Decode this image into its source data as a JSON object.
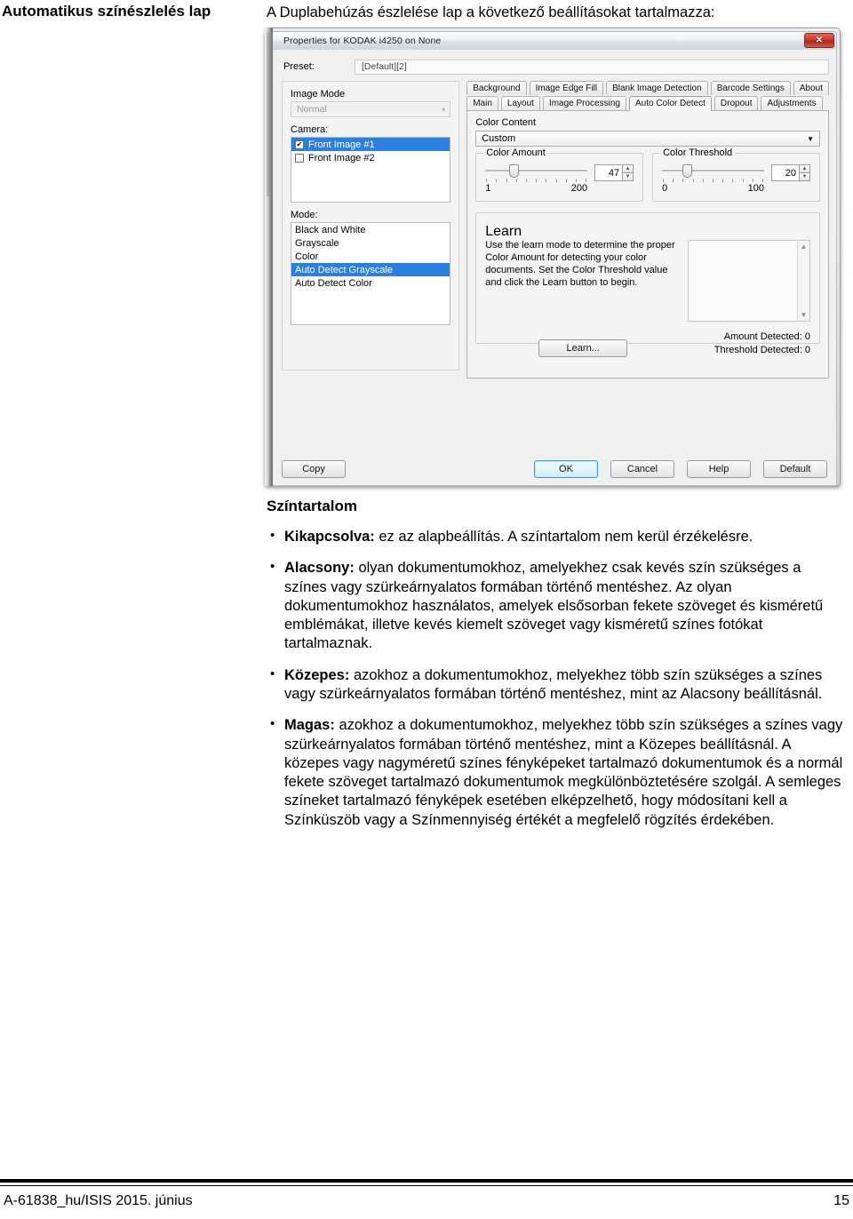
{
  "side_heading": "Automatikus színészlelés lap",
  "intro": "A Duplabehúzás észlelése lap a következő beállításokat tartalmazza:",
  "dialog": {
    "title": "Properties for KODAK i4250 on None",
    "close_icon": "close-icon",
    "preset": {
      "label": "Preset:",
      "value": "[Default][2]"
    },
    "image_mode": {
      "label": "Image Mode",
      "value": "Normal",
      "arrow": "▾"
    },
    "camera": {
      "label": "Camera:",
      "items": [
        {
          "label": "Front Image #1",
          "checked": true,
          "selected": true
        },
        {
          "label": "Front Image #2",
          "checked": false,
          "selected": false
        }
      ]
    },
    "mode": {
      "label": "Mode:",
      "items": [
        {
          "label": "Black and White",
          "selected": false
        },
        {
          "label": "Grayscale",
          "selected": false
        },
        {
          "label": "Color",
          "selected": false
        },
        {
          "label": "Auto Detect Grayscale",
          "selected": true
        },
        {
          "label": "Auto Detect Color",
          "selected": false
        }
      ]
    },
    "tabs_row1": [
      {
        "label": "Background",
        "active": false
      },
      {
        "label": "Image Edge Fill",
        "active": false
      },
      {
        "label": "Blank Image Detection",
        "active": false
      },
      {
        "label": "Barcode Settings",
        "active": false
      },
      {
        "label": "About",
        "active": false
      }
    ],
    "tabs_row2": [
      {
        "label": "Main",
        "active": false
      },
      {
        "label": "Layout",
        "active": false
      },
      {
        "label": "Image Processing",
        "active": false
      },
      {
        "label": "Auto Color Detect",
        "active": true
      },
      {
        "label": "Dropout",
        "active": false
      },
      {
        "label": "Adjustments",
        "active": false
      }
    ],
    "color_content": {
      "label": "Color Content",
      "value": "Custom",
      "arrow": "▼"
    },
    "color_amount": {
      "legend": "Color Amount",
      "value": "47",
      "min": "1",
      "max": "200",
      "thumb_pct": 23,
      "up": "▲",
      "down": "▼"
    },
    "color_threshold": {
      "legend": "Color Threshold",
      "value": "20",
      "min": "0",
      "max": "100",
      "thumb_pct": 20,
      "up": "▲",
      "down": "▼"
    },
    "learn": {
      "legend": "Learn",
      "description": "Use the learn mode to determine the proper Color Amount for detecting your color documents. Set the Color Threshold value and click the Learn button to begin.",
      "button": "Learn...",
      "scroll_up": "▲",
      "scroll_down": "▼",
      "amount_detected": "Amount Detected:  0",
      "threshold_detected": "Threshold Detected:  0"
    },
    "buttons": {
      "copy": "Copy",
      "ok": "OK",
      "cancel": "Cancel",
      "help": "Help",
      "default": "Default"
    },
    "accent_ok": "#3c9fd4",
    "accent_selection": "#2b7fe0"
  },
  "prose": {
    "heading": "Színtartalom",
    "bullets": [
      {
        "term": "Kikapcsolva:",
        "text": " ez az alapbeállítás. A színtartalom nem kerül érzékelésre."
      },
      {
        "term": "Alacsony:",
        "text": " olyan dokumentumokhoz, amelyekhez csak kevés szín szükséges a színes vagy szürkeárnyalatos formában történő mentéshez. Az olyan dokumentumokhoz használatos, amelyek elsősorban fekete szöveget és kisméretű emblémákat, illetve kevés kiemelt szöveget vagy kisméretű színes fotókat tartalmaznak."
      },
      {
        "term": "Közepes:",
        "text": " azokhoz a dokumentumokhoz, melyekhez több szín szükséges a színes vagy szürkeárnyalatos formában történő mentéshez, mint az Alacsony beállításnál."
      },
      {
        "term": "Magas:",
        "text": " azokhoz a dokumentumokhoz, melyekhez több szín szükséges a színes vagy szürkeárnyalatos formában történő mentéshez, mint a Közepes beállításnál. A közepes vagy nagyméretű színes fényképeket tartalmazó dokumentumok és a normál fekete szöveget tartalmazó dokumentumok megkülönböztetésére szolgál. A semleges színeket tartalmazó fényképek esetében elképzelhető, hogy módosítani kell a Színküszöb vagy a Színmennyiség értékét a megfelelő rögzítés érdekében."
      }
    ]
  },
  "footer": {
    "doc_id": "A-61838_hu/ISIS  2015. június",
    "page": "15"
  }
}
